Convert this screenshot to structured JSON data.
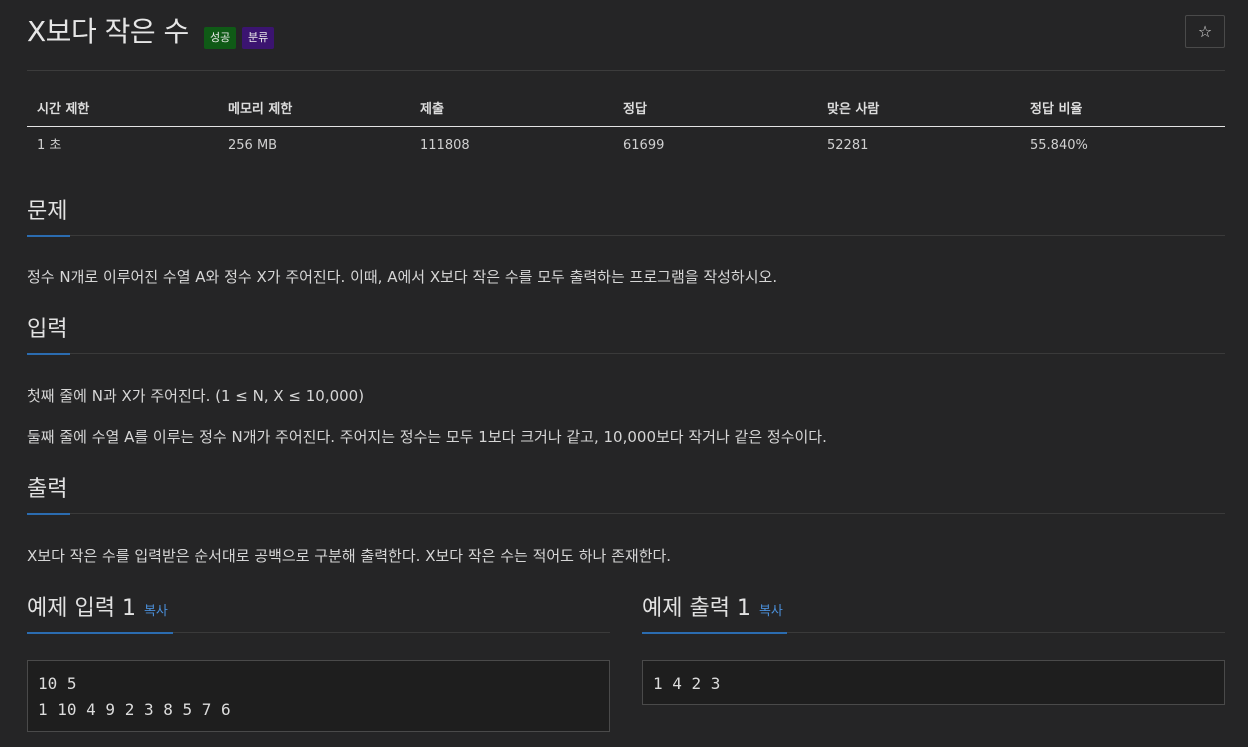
{
  "problem": {
    "title": "X보다 작은 수",
    "badges": {
      "success": "성공",
      "category": "분류"
    },
    "star": "☆"
  },
  "stats": {
    "headers": [
      "시간 제한",
      "메모리 제한",
      "제출",
      "정답",
      "맞은 사람",
      "정답 비율"
    ],
    "values": [
      "1 초",
      "256 MB",
      "111808",
      "61699",
      "52281",
      "55.840%"
    ]
  },
  "sections": {
    "problem": {
      "heading": "문제",
      "text": "정수 N개로 이루어진 수열 A와 정수 X가 주어진다. 이때, A에서 X보다 작은 수를 모두 출력하는 프로그램을 작성하시오."
    },
    "input": {
      "heading": "입력",
      "line1": "첫째 줄에 N과 X가 주어진다. (1 ≤ N, X ≤ 10,000)",
      "line2": "둘째 줄에 수열 A를 이루는 정수 N개가 주어진다. 주어지는 정수는 모두 1보다 크거나 같고, 10,000보다 작거나 같은 정수이다."
    },
    "output": {
      "heading": "출력",
      "text": "X보다 작은 수를 입력받은 순서대로 공백으로 구분해 출력한다. X보다 작은 수는 적어도 하나 존재한다."
    }
  },
  "examples": {
    "input": {
      "heading": "예제 입력 1",
      "copy": "복사",
      "content": "10 5\n1 10 4 9 2 3 8 5 7 6"
    },
    "output": {
      "heading": "예제 출력 1",
      "copy": "복사",
      "content": "1 4 2 3"
    }
  },
  "colors": {
    "accent": "#2b6cb0",
    "link": "#4a8fd9",
    "success_badge": "#0f5a16",
    "category_badge": "#3b1470"
  }
}
